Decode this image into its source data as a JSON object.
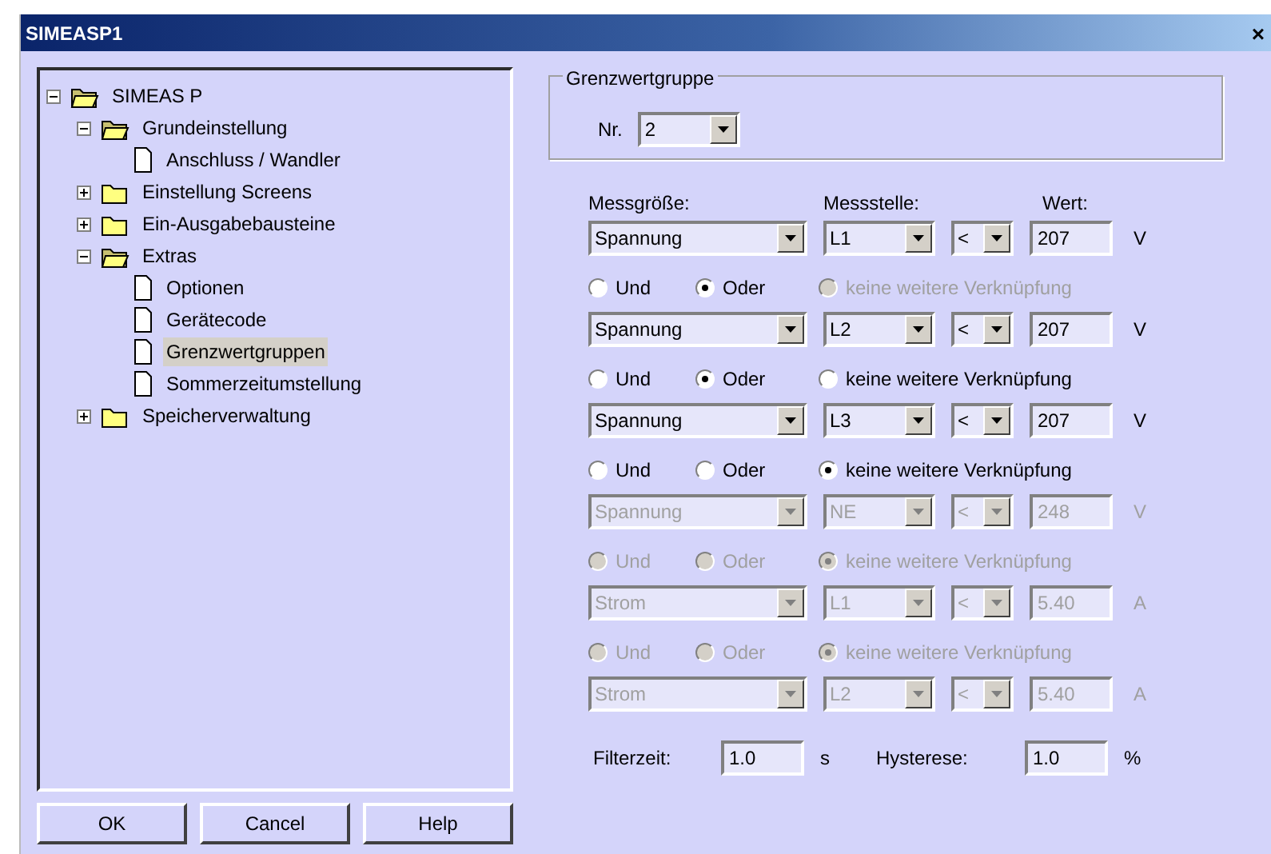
{
  "window": {
    "title": "SIMEASP1",
    "close": "×"
  },
  "tree": [
    {
      "label": "SIMEAS P",
      "kind": "folder",
      "expanded": true,
      "selected": false,
      "children": [
        {
          "label": "Grundeinstellung",
          "kind": "folder",
          "expanded": true,
          "selected": false,
          "children": [
            {
              "label": "Anschluss / Wandler",
              "kind": "document",
              "selected": false
            }
          ]
        },
        {
          "label": "Einstellung Screens",
          "kind": "folder",
          "expanded": false,
          "selected": false
        },
        {
          "label": "Ein-Ausgabebausteine",
          "kind": "folder",
          "expanded": false,
          "selected": false
        },
        {
          "label": "Extras",
          "kind": "folder",
          "expanded": true,
          "selected": false,
          "children": [
            {
              "label": "Optionen",
              "kind": "document",
              "selected": false
            },
            {
              "label": "Gerätecode",
              "kind": "document",
              "selected": false
            },
            {
              "label": "Grenzwertgruppen",
              "kind": "document",
              "selected": true
            },
            {
              "label": "Sommerzeitumstellung",
              "kind": "document",
              "selected": false
            }
          ]
        },
        {
          "label": "Speicherverwaltung",
          "kind": "folder",
          "expanded": false,
          "selected": false
        }
      ]
    }
  ],
  "buttons": [
    "OK",
    "Cancel",
    "Help"
  ],
  "group": {
    "title": "Grenzwertgruppe",
    "label": "Nr.",
    "value": "2"
  },
  "columns": [
    "Messgröße:",
    "Messstelle:",
    "Wert:"
  ],
  "rows": [
    {
      "measure": "Spannung",
      "point": "L1",
      "operator": "<",
      "value": "207",
      "unit": "V",
      "disabled": false,
      "link": [
        {
          "label": "Und",
          "selected": false,
          "disabled": false
        },
        {
          "label": "Oder",
          "selected": true,
          "disabled": false
        },
        {
          "label": "keine weitere Verknüpfung",
          "selected": false,
          "disabled": true
        }
      ]
    },
    {
      "measure": "Spannung",
      "point": "L2",
      "operator": "<",
      "value": "207",
      "unit": "V",
      "disabled": false,
      "link": [
        {
          "label": "Und",
          "selected": false,
          "disabled": false
        },
        {
          "label": "Oder",
          "selected": true,
          "disabled": false
        },
        {
          "label": "keine weitere Verknüpfung",
          "selected": false,
          "disabled": false
        }
      ]
    },
    {
      "measure": "Spannung",
      "point": "L3",
      "operator": "<",
      "value": "207",
      "unit": "V",
      "disabled": false,
      "link": [
        {
          "label": "Und",
          "selected": false,
          "disabled": false
        },
        {
          "label": "Oder",
          "selected": false,
          "disabled": false
        },
        {
          "label": "keine weitere Verknüpfung",
          "selected": true,
          "disabled": false
        }
      ]
    },
    {
      "measure": "Spannung",
      "point": "NE",
      "operator": "<",
      "value": "248",
      "unit": "V",
      "disabled": true,
      "link": [
        {
          "label": "Und",
          "selected": false,
          "disabled": true
        },
        {
          "label": "Oder",
          "selected": false,
          "disabled": true
        },
        {
          "label": "keine weitere Verknüpfung",
          "selected": true,
          "disabled": true
        }
      ]
    },
    {
      "measure": "Strom",
      "point": "L1",
      "operator": "<",
      "value": "5.40",
      "unit": "A",
      "disabled": true,
      "link": [
        {
          "label": "Und",
          "selected": false,
          "disabled": true
        },
        {
          "label": "Oder",
          "selected": false,
          "disabled": true
        },
        {
          "label": "keine weitere Verknüpfung",
          "selected": true,
          "disabled": true
        }
      ]
    },
    {
      "measure": "Strom",
      "point": "L2",
      "operator": "<",
      "value": "5.40",
      "unit": "A",
      "disabled": true
    }
  ],
  "filter": {
    "label": "Filterzeit:",
    "value": "1.0",
    "unit": "s"
  },
  "hysteresis": {
    "label": "Hysterese:",
    "value": "1.0",
    "unit": "%"
  }
}
